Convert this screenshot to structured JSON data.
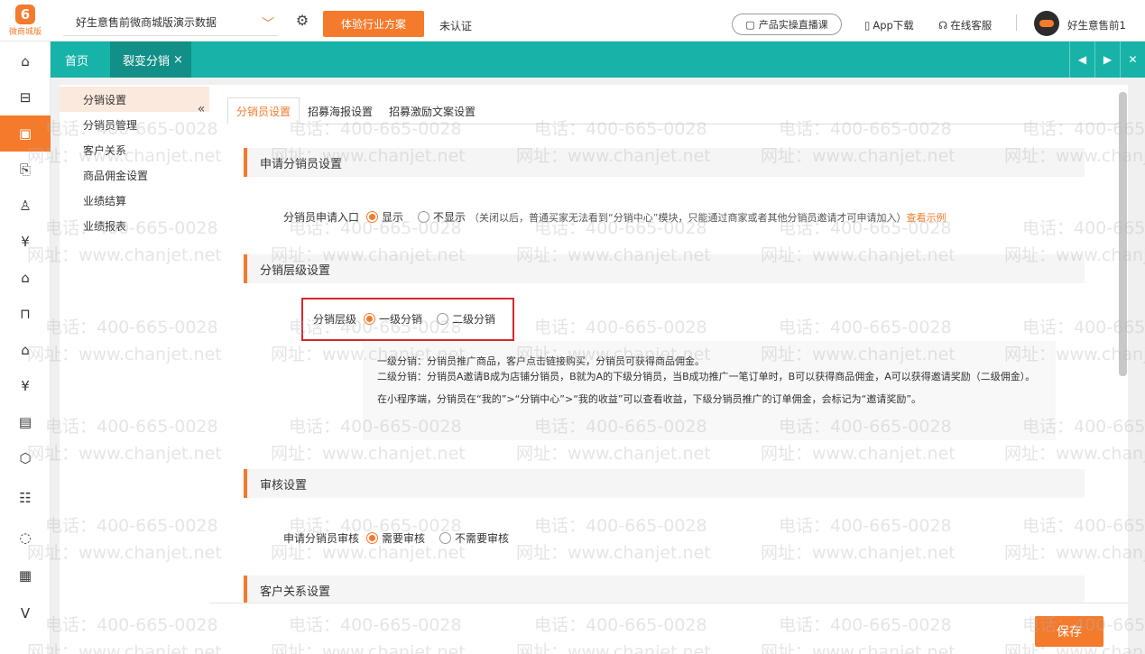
{
  "header": {
    "logo_text": "微商城版",
    "logo_mark": "6",
    "store_name": "好生意售前微商城版演示数据",
    "trial_button": "体验行业方案",
    "auth_status": "未认证",
    "live_course": "产品实操直播课",
    "app_download": "App下载",
    "online_service": "在线客服",
    "username": "好生意售前1"
  },
  "rail": {
    "icons": [
      "home-icon",
      "store-icon",
      "marketing-icon",
      "coupon-icon",
      "user-icon",
      "finance-icon",
      "shop-icon",
      "bag-icon",
      "warehouse-icon",
      "money-icon",
      "clipboard-icon",
      "box-icon",
      "card-icon",
      "loading-icon",
      "news-icon",
      "vip-icon"
    ],
    "active_index": 2
  },
  "tabs": {
    "home": "首页",
    "current": "裂变分销",
    "close": "×",
    "prev": "◀",
    "next": "▶",
    "close_all": "✕"
  },
  "submenu": {
    "items": [
      "分销设置",
      "分销员管理",
      "客户关系",
      "商品佣金设置",
      "业绩结算",
      "业绩报表"
    ],
    "active_index": 0,
    "collapse": "«"
  },
  "inner_tabs": [
    "分销员设置",
    "招募海报设置",
    "招募激励文案设置"
  ],
  "sections": {
    "apply": {
      "title": "申请分销员设置",
      "label": "分销员申请入口",
      "opt_show": "显示",
      "opt_hide": "不显示",
      "hint": "（关闭以后，普通买家无法看到“分销中心”模块，只能通过商家或者其他分销员邀请才可申请加入）",
      "link": "查看示例"
    },
    "level": {
      "title": "分销层级设置",
      "label": "分销层级",
      "opt_one": "一级分销",
      "opt_two": "二级分销",
      "note1": "一级分销：分销员推广商品，客户点击链接购买，分销员可获得商品佣金。",
      "note2": "二级分销：分销员A邀请B成为店铺分销员，B就为A的下级分销员，当B成功推广一笔订单时，B可以获得商品佣金，A可以获得邀请奖励（二级佣金）。",
      "note3": "在小程序端，分销员在“我的”>“分销中心”>“我的收益”可以查看收益，下级分销员推广的订单佣金，会标记为“邀请奖励”。"
    },
    "audit": {
      "title": "审核设置",
      "label": "申请分销员审核",
      "opt_need": "需要审核",
      "opt_no": "不需要审核"
    },
    "customer": {
      "title": "客户关系设置"
    }
  },
  "footer": {
    "save": "保存"
  },
  "watermark": {
    "phone": "电话：400-665-0028",
    "site": "网址：www.chanjet.net"
  },
  "colors": {
    "accent": "#f47a2c",
    "teal": "#17b3a8",
    "highlight": "#d9262c"
  }
}
